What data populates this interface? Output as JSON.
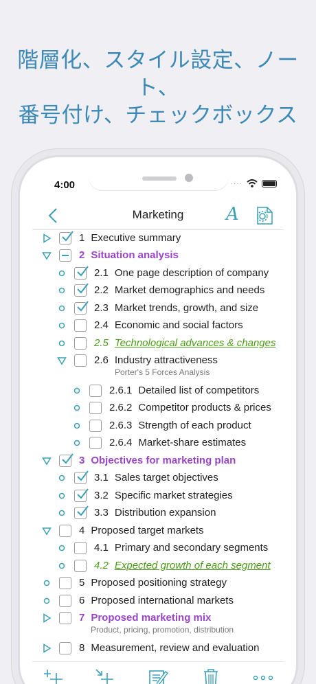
{
  "promo": {
    "line1": "階層化、スタイル設定、ノート、",
    "line2": "番号付け、チェックボックス"
  },
  "status": {
    "time": "4:00"
  },
  "nav": {
    "title": "Marketing"
  },
  "colors": {
    "accent": "#3aa0b6",
    "heading": "#9a45c7",
    "link": "#4c9a18",
    "promo": "#3d8ab7"
  },
  "rows": [
    {
      "num": "1",
      "label": "Executive summary",
      "ctrl": "collapsed",
      "check": "checked",
      "style": "normal"
    },
    {
      "num": "2",
      "label": "Situation analysis",
      "ctrl": "expanded",
      "check": "partial",
      "style": "heading"
    },
    {
      "num": "2.1",
      "label": "One page description of company",
      "ctrl": "leaf",
      "check": "checked",
      "style": "normal"
    },
    {
      "num": "2.2",
      "label": "Market demographics and needs",
      "ctrl": "leaf",
      "check": "checked",
      "style": "normal"
    },
    {
      "num": "2.3",
      "label": "Market trends, growth, and size",
      "ctrl": "leaf",
      "check": "checked",
      "style": "normal"
    },
    {
      "num": "2.4",
      "label": "Economic and social factors",
      "ctrl": "leaf",
      "check": "unchecked",
      "style": "normal"
    },
    {
      "num": "2.5",
      "label": "Technological advances & changes",
      "ctrl": "leaf",
      "check": "unchecked",
      "style": "link"
    },
    {
      "num": "2.6",
      "label": "Industry attractiveness",
      "note": "Porter's 5 Forces Analysis",
      "ctrl": "expanded",
      "check": "unchecked",
      "style": "normal"
    },
    {
      "num": "2.6.1",
      "label": "Detailed list of competitors",
      "ctrl": "leaf",
      "check": "unchecked",
      "style": "normal"
    },
    {
      "num": "2.6.2",
      "label": "Competitor products & prices",
      "ctrl": "leaf",
      "check": "unchecked",
      "style": "normal"
    },
    {
      "num": "2.6.3",
      "label": "Strength of each product",
      "ctrl": "leaf",
      "check": "unchecked",
      "style": "normal"
    },
    {
      "num": "2.6.4",
      "label": "Market-share estimates",
      "ctrl": "leaf",
      "check": "unchecked",
      "style": "normal"
    },
    {
      "num": "3",
      "label": "Objectives for marketing plan",
      "ctrl": "expanded",
      "check": "checked",
      "style": "heading"
    },
    {
      "num": "3.1",
      "label": "Sales target objectives",
      "ctrl": "leaf",
      "check": "checked",
      "style": "normal"
    },
    {
      "num": "3.2",
      "label": "Specific market strategies",
      "ctrl": "leaf",
      "check": "checked",
      "style": "normal"
    },
    {
      "num": "3.3",
      "label": "Distribution expansion",
      "ctrl": "leaf",
      "check": "checked",
      "style": "normal"
    },
    {
      "num": "4",
      "label": "Proposed target markets",
      "ctrl": "expanded",
      "check": "unchecked",
      "style": "normal"
    },
    {
      "num": "4.1",
      "label": "Primary and secondary segments",
      "ctrl": "leaf",
      "check": "unchecked",
      "style": "normal"
    },
    {
      "num": "4.2",
      "label": "Expected growth of each segment",
      "ctrl": "leaf",
      "check": "unchecked",
      "style": "link"
    },
    {
      "num": "5",
      "label": "Proposed positioning strategy",
      "ctrl": "leaf",
      "check": "unchecked",
      "style": "normal"
    },
    {
      "num": "6",
      "label": "Proposed international markets",
      "ctrl": "leaf",
      "check": "unchecked",
      "style": "normal"
    },
    {
      "num": "7",
      "label": "Proposed marketing mix",
      "note": "Product, pricing, promotion, distribution",
      "ctrl": "collapsed",
      "check": "unchecked",
      "style": "heading"
    },
    {
      "num": "8",
      "label": "Measurement, review and evaluation",
      "ctrl": "collapsed",
      "check": "unchecked",
      "style": "normal"
    }
  ],
  "toolbar": {
    "icons": [
      "add-sibling-icon",
      "add-child-icon",
      "edit-note-icon",
      "trash-icon",
      "more-icon"
    ]
  }
}
